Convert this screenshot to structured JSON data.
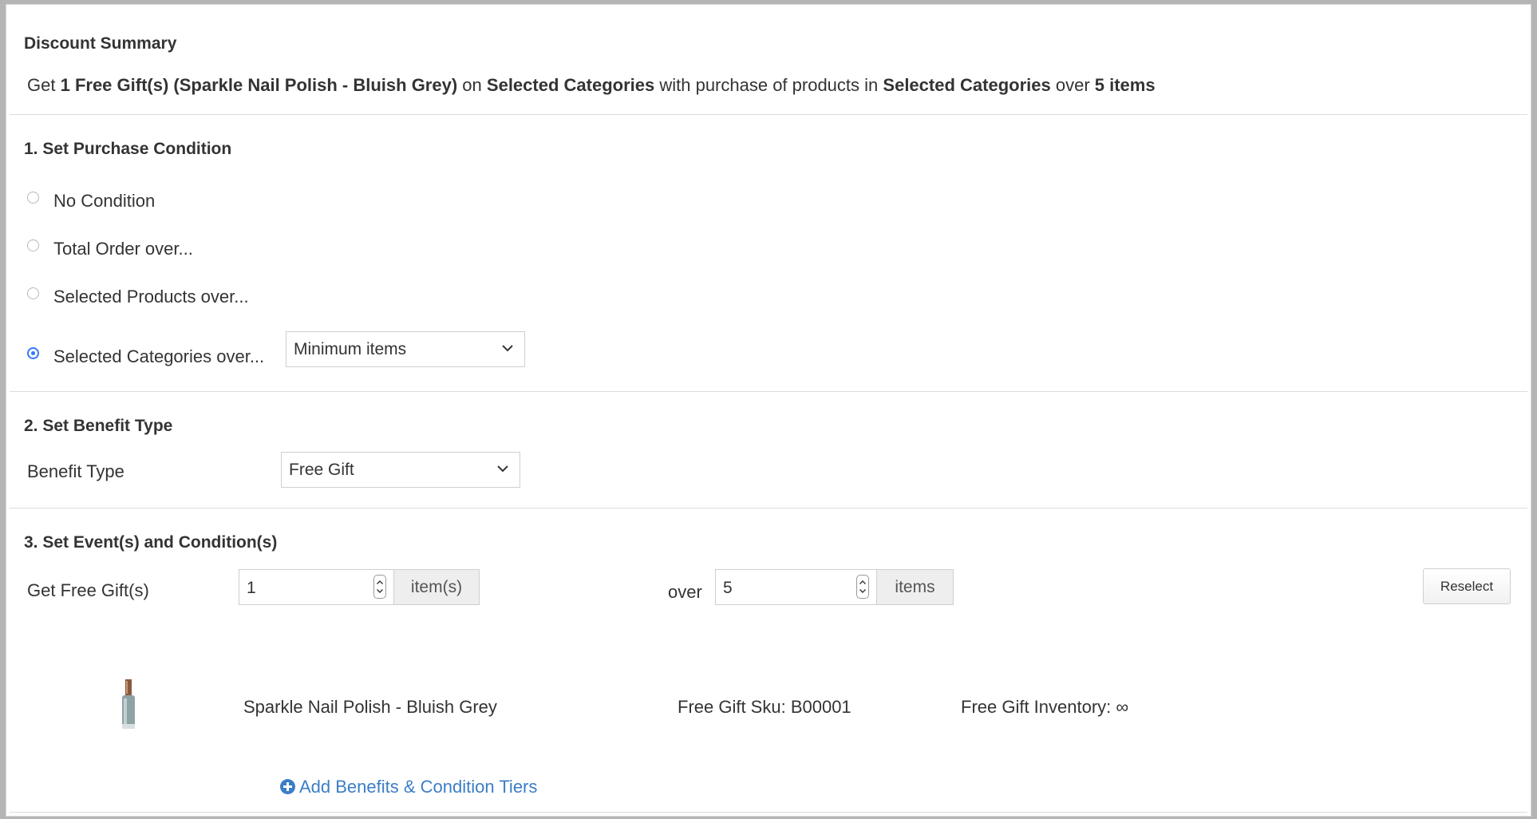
{
  "discount_summary": {
    "title": "Discount Summary",
    "parts": {
      "get": "Get",
      "gift": "1 Free Gift(s) (Sparkle Nail Polish - Bluish Grey)",
      "on": "on",
      "categories1": "Selected Categories",
      "with_purchase": "with purchase of products in",
      "categories2": "Selected Categories",
      "over": "over",
      "threshold": "5 items"
    }
  },
  "purchase_condition": {
    "title": "1. Set Purchase Condition",
    "options": [
      {
        "label": "No Condition",
        "checked": false
      },
      {
        "label": "Total Order over...",
        "checked": false
      },
      {
        "label": "Selected Products over...",
        "checked": false
      },
      {
        "label": "Selected Categories over...",
        "checked": true
      }
    ],
    "condition_select": "Minimum items"
  },
  "benefit": {
    "title": "2. Set Benefit Type",
    "label": "Benefit Type",
    "select_value": "Free Gift"
  },
  "event": {
    "title": "3. Set Event(s) and Condition(s)",
    "get_label": "Get Free Gift(s)",
    "gift_quantity": "1",
    "gift_unit": "item(s)",
    "over_label": "over",
    "threshold": "5",
    "threshold_unit": "items",
    "reselect": "Reselect"
  },
  "gift_item": {
    "name": "Sparkle Nail Polish - Bluish Grey",
    "sku": "Free Gift Sku: B00001",
    "inventory": "Free Gift Inventory: ∞",
    "image_icon": "nail-polish-bottle"
  },
  "add_tiers_link": "Add Benefits & Condition Tiers",
  "colors": {
    "accent": "#3478f6",
    "link": "#3b7ec6",
    "border": "#cfcfcf",
    "addon_bg": "#eeeeee"
  }
}
